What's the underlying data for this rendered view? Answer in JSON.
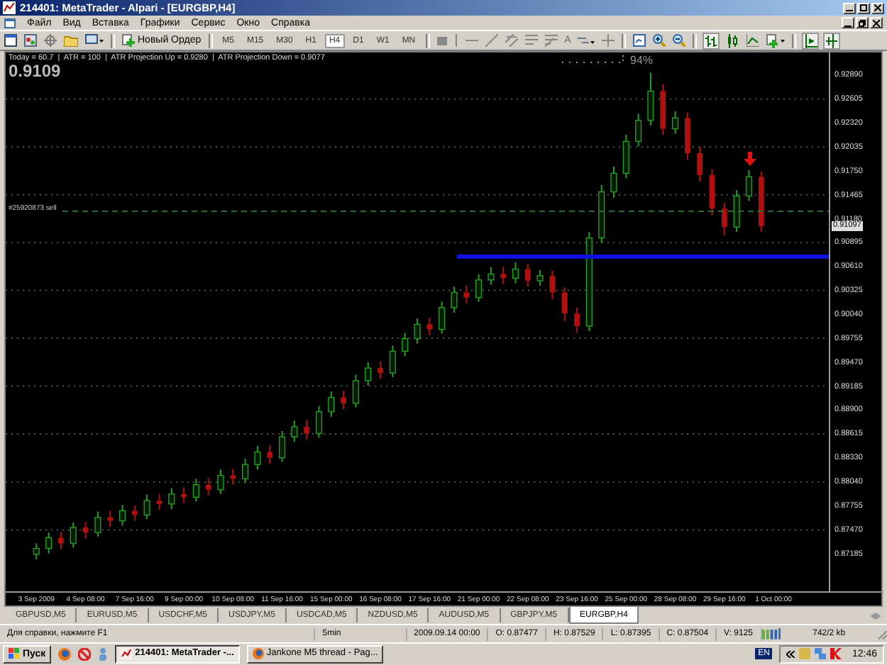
{
  "window": {
    "title": "214401: MetaTrader - Alpari - [EURGBP,H4]"
  },
  "menu": [
    "Файл",
    "Вид",
    "Вставка",
    "Графики",
    "Сервис",
    "Окно",
    "Справка"
  ],
  "toolbar": {
    "new_order": "Новый Ордер",
    "text_tool": "A",
    "timeframes": [
      {
        "label": "M5",
        "selected": false
      },
      {
        "label": "M15",
        "selected": false
      },
      {
        "label": "M30",
        "selected": false
      },
      {
        "label": "H1",
        "selected": false
      },
      {
        "label": "H4",
        "selected": true
      },
      {
        "label": "D1",
        "selected": false
      },
      {
        "label": "W1",
        "selected": false
      },
      {
        "label": "MN",
        "selected": false
      }
    ]
  },
  "chart": {
    "indicator_line": "Today = 60.7  |  ATR = 100  |  ATR Projection Up = 0.9280  |  ATR Projection Down = 0.9077",
    "price": "0.9109",
    "percent": "94%",
    "order_label": "#25920873 sell",
    "current_price": "0.91097",
    "chart_data": {
      "type": "candlestick",
      "categories": [
        null,
        null,
        "3 Sep 2009",
        null,
        null,
        null,
        "4 Sep 08:00",
        null,
        null,
        null,
        "7 Sep 16:00",
        null,
        null,
        null,
        "9 Sep 00:00",
        null,
        null,
        null,
        "10 Sep 08:00",
        null,
        null,
        null,
        "11 Sep 16:00",
        null,
        null,
        null,
        "15 Sep 00:00",
        null,
        null,
        null,
        "16 Sep 08:00",
        null,
        null,
        null,
        "17 Sep 16:00",
        null,
        null,
        null,
        "21 Sep 00:00",
        null,
        null,
        null,
        "22 Sep 08:00",
        null,
        null,
        null,
        "23 Sep 16:00",
        null,
        null,
        null,
        "25 Sep 00:00",
        null,
        null,
        null,
        "28 Sep 08:00",
        null,
        null,
        null,
        "29 Sep 16:00",
        null,
        null,
        null,
        "1 Oct 00:00",
        null,
        null,
        null,
        null
      ],
      "ohlc": [
        null,
        null,
        [
          0.8718,
          0.8731,
          0.8712,
          0.8725
        ],
        [
          0.8725,
          0.8744,
          0.8719,
          0.8738
        ],
        [
          0.8738,
          0.8745,
          0.8724,
          0.8731
        ],
        [
          0.8731,
          0.8756,
          0.8726,
          0.875
        ],
        [
          0.875,
          0.8757,
          0.8737,
          0.8744
        ],
        [
          0.8744,
          0.8769,
          0.8739,
          0.8762
        ],
        [
          0.8762,
          0.877,
          0.8751,
          0.8758
        ],
        [
          0.8758,
          0.8777,
          0.8752,
          0.877
        ],
        [
          0.877,
          0.8776,
          0.8758,
          0.8765
        ],
        [
          0.8765,
          0.8789,
          0.876,
          0.8782
        ],
        [
          0.8782,
          0.879,
          0.8771,
          0.8778
        ],
        [
          0.8778,
          0.8797,
          0.8772,
          0.879
        ],
        [
          0.879,
          0.8798,
          0.8779,
          0.8786
        ],
        [
          0.8786,
          0.8808,
          0.8781,
          0.8801
        ],
        [
          0.8801,
          0.8809,
          0.8788,
          0.8795
        ],
        [
          0.8795,
          0.8819,
          0.879,
          0.8812
        ],
        [
          0.8812,
          0.882,
          0.8801,
          0.8808
        ],
        [
          0.8808,
          0.8832,
          0.8803,
          0.8825
        ],
        [
          0.8825,
          0.8847,
          0.8819,
          0.884
        ],
        [
          0.884,
          0.8848,
          0.8826,
          0.8833
        ],
        [
          0.8833,
          0.8865,
          0.8828,
          0.8858
        ],
        [
          0.8858,
          0.8877,
          0.8852,
          0.887
        ],
        [
          0.887,
          0.8878,
          0.8855,
          0.8862
        ],
        [
          0.8862,
          0.8895,
          0.8857,
          0.8888
        ],
        [
          0.8888,
          0.8912,
          0.8882,
          0.8905
        ],
        [
          0.8905,
          0.8913,
          0.8891,
          0.8898
        ],
        [
          0.8898,
          0.8932,
          0.8893,
          0.8925
        ],
        [
          0.8925,
          0.8947,
          0.8919,
          0.894
        ],
        [
          0.894,
          0.8948,
          0.8927,
          0.8934
        ],
        [
          0.8934,
          0.8967,
          0.8929,
          0.896
        ],
        [
          0.896,
          0.8982,
          0.8954,
          0.8975
        ],
        [
          0.8975,
          0.8999,
          0.8969,
          0.8992
        ],
        [
          0.8992,
          0.9,
          0.8979,
          0.8986
        ],
        [
          0.8986,
          0.9019,
          0.8981,
          0.9012
        ],
        [
          0.9012,
          0.9037,
          0.9006,
          0.903
        ],
        [
          0.903,
          0.9038,
          0.9017,
          0.9024
        ],
        [
          0.9024,
          0.9052,
          0.9019,
          0.9045
        ],
        [
          0.9045,
          0.906,
          0.9039,
          0.9052
        ],
        [
          0.9052,
          0.9061,
          0.904,
          0.9047
        ],
        [
          0.9047,
          0.9066,
          0.9041,
          0.9058
        ],
        [
          0.9058,
          0.9064,
          0.9037,
          0.9044
        ],
        [
          0.9044,
          0.9057,
          0.9038,
          0.905
        ],
        [
          0.905,
          0.9056,
          0.9022,
          0.903
        ],
        [
          0.903,
          0.9036,
          0.8996,
          0.9005
        ],
        [
          0.9005,
          0.9012,
          0.8982,
          0.899
        ],
        [
          0.899,
          0.9102,
          0.8984,
          0.9095
        ],
        [
          0.9095,
          0.9158,
          0.9089,
          0.915
        ],
        [
          0.915,
          0.918,
          0.9143,
          0.9172
        ],
        [
          0.9172,
          0.9218,
          0.9166,
          0.921
        ],
        [
          0.921,
          0.9243,
          0.9204,
          0.9235
        ],
        [
          0.9235,
          0.9292,
          0.9229,
          0.927
        ],
        [
          0.927,
          0.9278,
          0.9218,
          0.9225
        ],
        [
          0.9225,
          0.9246,
          0.9219,
          0.9238
        ],
        [
          0.9238,
          0.9245,
          0.9188,
          0.9196
        ],
        [
          0.9196,
          0.9204,
          0.9162,
          0.917
        ],
        [
          0.917,
          0.9177,
          0.9122,
          0.913
        ],
        [
          0.913,
          0.9137,
          0.9098,
          0.9108
        ],
        [
          0.9108,
          0.9152,
          0.9102,
          0.9145
        ],
        [
          0.9145,
          0.9176,
          0.9139,
          0.9168
        ],
        [
          0.9168,
          0.9174,
          0.9102,
          0.9109
        ],
        null,
        null,
        null,
        null,
        null
      ],
      "ylim": [
        0.8674,
        0.9316
      ],
      "grid": true,
      "yticks": [
        {
          "value": 0.9289,
          "label": "0.92890"
        },
        {
          "value": 0.92605,
          "label": "0.92605"
        },
        {
          "value": 0.9232,
          "label": "0.92320"
        },
        {
          "value": 0.92035,
          "label": "0.92035"
        },
        {
          "value": 0.9175,
          "label": "0.91750"
        },
        {
          "value": 0.91465,
          "label": "0.91465"
        },
        {
          "value": 0.9118,
          "label": "0.91180"
        },
        {
          "value": 0.90895,
          "label": "0.90895"
        },
        {
          "value": 0.9061,
          "label": "0.90610"
        },
        {
          "value": 0.90325,
          "label": "0.90325"
        },
        {
          "value": 0.9004,
          "label": "0.90040"
        },
        {
          "value": 0.89755,
          "label": "0.89755"
        },
        {
          "value": 0.8947,
          "label": "0.89470"
        },
        {
          "value": 0.89185,
          "label": "0.89185"
        },
        {
          "value": 0.889,
          "label": "0.88900"
        },
        {
          "value": 0.88615,
          "label": "0.88615"
        },
        {
          "value": 0.8833,
          "label": "0.88330"
        },
        {
          "value": 0.8804,
          "label": "0.88040"
        },
        {
          "value": 0.87755,
          "label": "0.87755"
        },
        {
          "value": 0.8747,
          "label": "0.87470"
        },
        {
          "value": 0.87185,
          "label": "0.87185"
        }
      ]
    }
  },
  "tabs": [
    {
      "label": "GBPUSD,M5",
      "selected": false
    },
    {
      "label": "EURUSD,M5",
      "selected": false
    },
    {
      "label": "USDCHF,M5",
      "selected": false
    },
    {
      "label": "USDJPY,M5",
      "selected": false
    },
    {
      "label": "USDCAD,M5",
      "selected": false
    },
    {
      "label": "NZDUSD,M5",
      "selected": false
    },
    {
      "label": "AUDUSD,M5",
      "selected": false
    },
    {
      "label": "GBPJPY,M5",
      "selected": false
    },
    {
      "label": "EURGBP,H4",
      "selected": true
    }
  ],
  "status_bar": {
    "help": "Для справки, нажмите F1",
    "timeframe": "5min",
    "datetime": "2009.09.14 00:00",
    "open": "O: 0.87477",
    "high": "H: 0.87529",
    "low": "L: 0.87395",
    "close": "C: 0.87504",
    "volume": "V: 9125",
    "traffic": "742/2 kb"
  },
  "taskbar": {
    "start": "Пуск",
    "tasks": [
      {
        "label": "214401: MetaTrader -...",
        "selected": true
      },
      {
        "label": "Jankone M5 thread - Pag...",
        "selected": false
      }
    ],
    "language": "EN",
    "clock": "12:46"
  }
}
